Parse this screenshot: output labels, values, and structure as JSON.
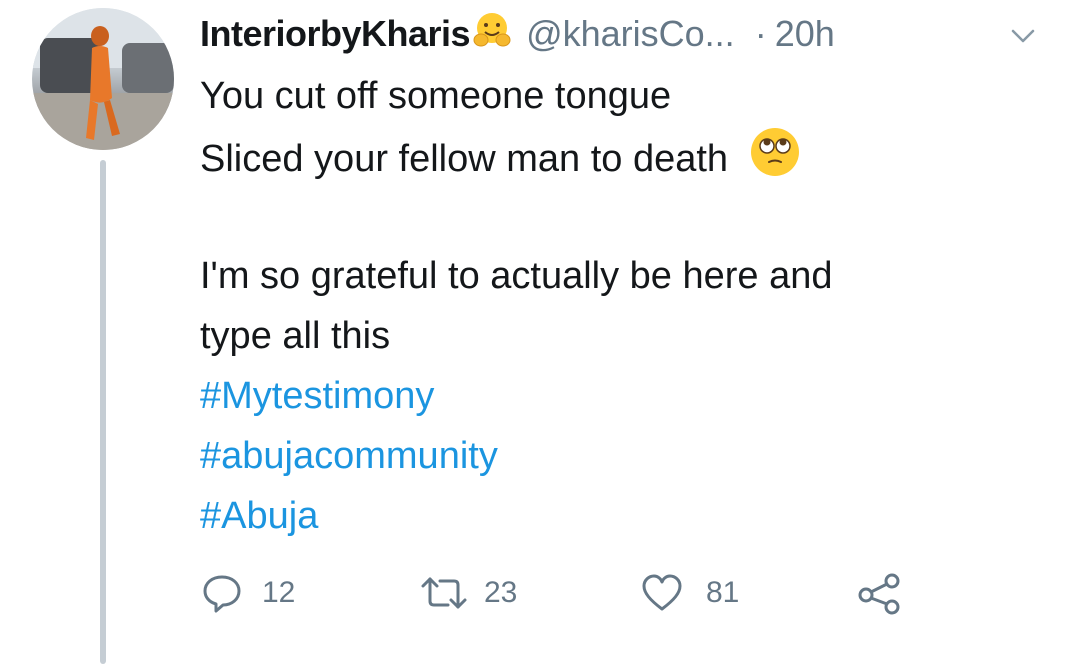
{
  "tweet": {
    "display_name": "InteriorbyKharis",
    "display_name_emoji": "hugging-face-emoji",
    "handle": "@kharisCo...",
    "separator": "·",
    "time": "20h",
    "lines": [
      "You cut off someone tongue",
      "Sliced your fellow man to death",
      "",
      "I'm so grateful to actually be here and",
      "type all this"
    ],
    "inline_emoji": "face-with-rolling-eyes-emoji",
    "hashtags": [
      "#Mytestimony",
      "#abujacommunity",
      "#Abuja"
    ]
  },
  "actions": {
    "reply_count": "12",
    "retweet_count": "23",
    "like_count": "81"
  },
  "colors": {
    "text": "#14171a",
    "secondary": "#657786",
    "link": "#1b95e0",
    "thread_line": "#c5cdd4"
  },
  "icons": [
    "chevron-down-icon",
    "reply-icon",
    "retweet-icon",
    "like-icon",
    "share-icon"
  ]
}
